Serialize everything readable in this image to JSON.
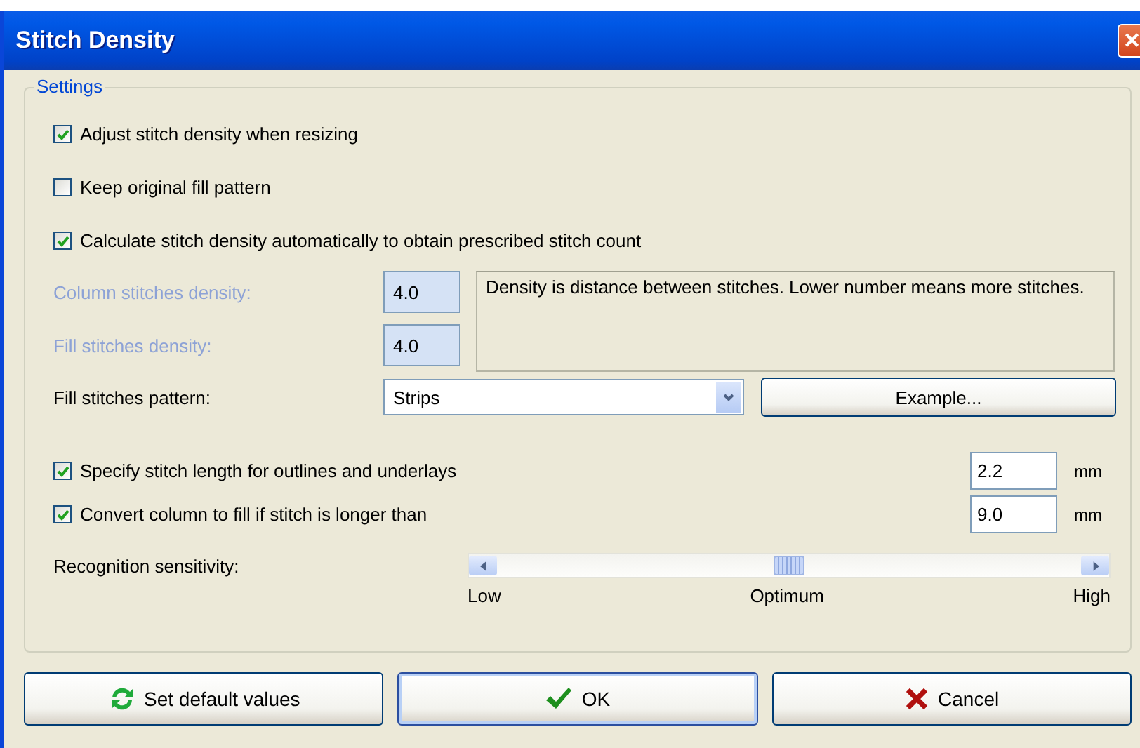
{
  "window": {
    "title": "Stitch Density",
    "close": "✕"
  },
  "group": {
    "title": "Settings"
  },
  "options": [
    {
      "label": "Adjust stitch density when resizing",
      "checked": true
    },
    {
      "label": "Keep original fill pattern",
      "checked": false
    },
    {
      "label": "Calculate stitch density automatically to obtain prescribed stitch count",
      "checked": true
    }
  ],
  "density_fields": [
    {
      "label": "Column stitches density:",
      "value": "4.0",
      "disabled": true
    },
    {
      "label": "Fill stitches density:",
      "value": "4.0",
      "disabled": true
    }
  ],
  "density_note": "Density is distance between stitches. Lower number means more stitches.",
  "pattern": {
    "label": "Fill stitches pattern:",
    "value": "Strips",
    "button": "Example..."
  },
  "length_options": [
    {
      "label": "Specify stitch length for outlines and underlays",
      "checked": true,
      "value": "2.2",
      "unit": "mm"
    },
    {
      "label": "Convert column to fill if stitch is longer than",
      "checked": true,
      "value": "9.0",
      "unit": "mm"
    }
  ],
  "sensitivity": {
    "label": "Recognition sensitivity:",
    "level": 0.5,
    "ticks": [
      "Low",
      "Optimum",
      "High"
    ]
  },
  "buttons": [
    {
      "kind": "reset",
      "label": "Set default values",
      "selected": false
    },
    {
      "kind": "ok",
      "label": "OK",
      "selected": true
    },
    {
      "kind": "cancel",
      "label": "Cancel",
      "selected": false
    }
  ]
}
